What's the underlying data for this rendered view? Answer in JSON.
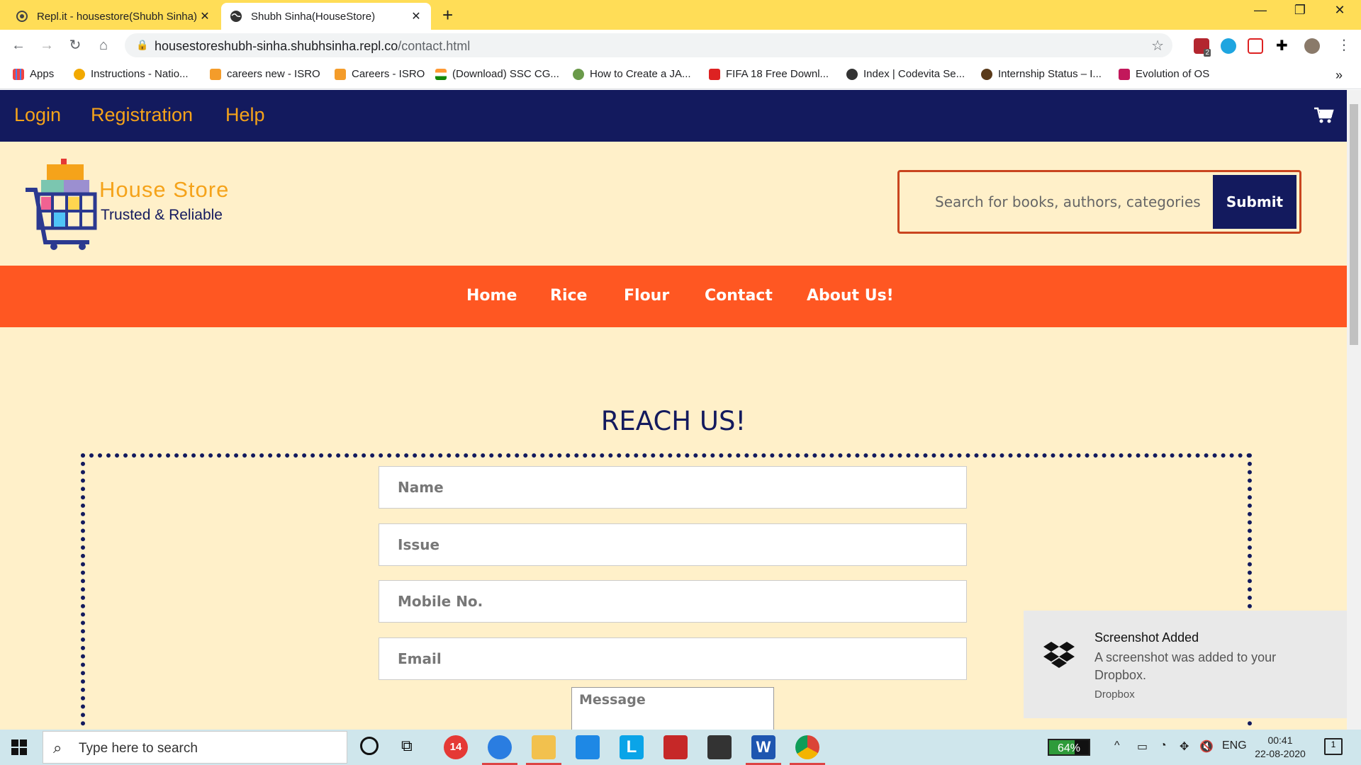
{
  "browser": {
    "tabs": [
      {
        "title": "Repl.it - housestore(Shubh Sinha)",
        "icon": "replit-icon",
        "active": false
      },
      {
        "title": "Shubh Sinha(HouseStore)",
        "icon": "globe-icon",
        "active": true
      }
    ],
    "url_host": "housestoreshubh-sinha.shubhsinha.repl.co",
    "url_path": "/contact.html",
    "bookmarks": [
      {
        "label": "Apps",
        "icon": "apps-grid-icon"
      },
      {
        "label": "Instructions - Natio...",
        "icon": "bulb-icon"
      },
      {
        "label": "careers new - ISRO",
        "icon": "isro-icon"
      },
      {
        "label": "Careers - ISRO",
        "icon": "isro-icon"
      },
      {
        "label": "(Download) SSC CG...",
        "icon": "india-flag-icon"
      },
      {
        "label": "How to Create a JA...",
        "icon": "site-icon"
      },
      {
        "label": "FIFA 18 Free Downl...",
        "icon": "gamepad-icon"
      },
      {
        "label": "Index | Codevita Se...",
        "icon": "globe-icon"
      },
      {
        "label": "Internship Status – I...",
        "icon": "site-icon"
      },
      {
        "label": "Evolution of OS",
        "icon": "site-icon"
      }
    ],
    "extension_badge": "2"
  },
  "topnav": {
    "links": [
      "Login",
      "Registration",
      "Help"
    ],
    "cart_icon": "cart-icon"
  },
  "brand": {
    "name": "House Store",
    "tagline": "Trusted & Reliable"
  },
  "search": {
    "placeholder": "Search for books, authors, categories",
    "button": "Submit"
  },
  "catnav": {
    "links": [
      "Home",
      "Rice",
      "Flour",
      "Contact",
      "About Us!"
    ]
  },
  "contact": {
    "title": "REACH US!",
    "fields": {
      "name": "Name",
      "issue": "Issue",
      "mobile": "Mobile No.",
      "email": "Email",
      "message": "Message"
    }
  },
  "toast": {
    "title": "Screenshot Added",
    "body": "A screenshot was added to your Dropbox.",
    "source": "Dropbox"
  },
  "taskbar": {
    "search_placeholder": "Type here to search",
    "mail_badge": "14",
    "battery_percent": 64,
    "battery_label": "64%",
    "language": "ENG",
    "time": "00:41",
    "date": "22-08-2020",
    "notification_count": "1"
  },
  "colors": {
    "navy": "#131a5e",
    "orange": "#ff5722",
    "gold": "#f5a31a",
    "cream": "#fff0c9",
    "tabbar_yellow": "#ffdd57"
  }
}
